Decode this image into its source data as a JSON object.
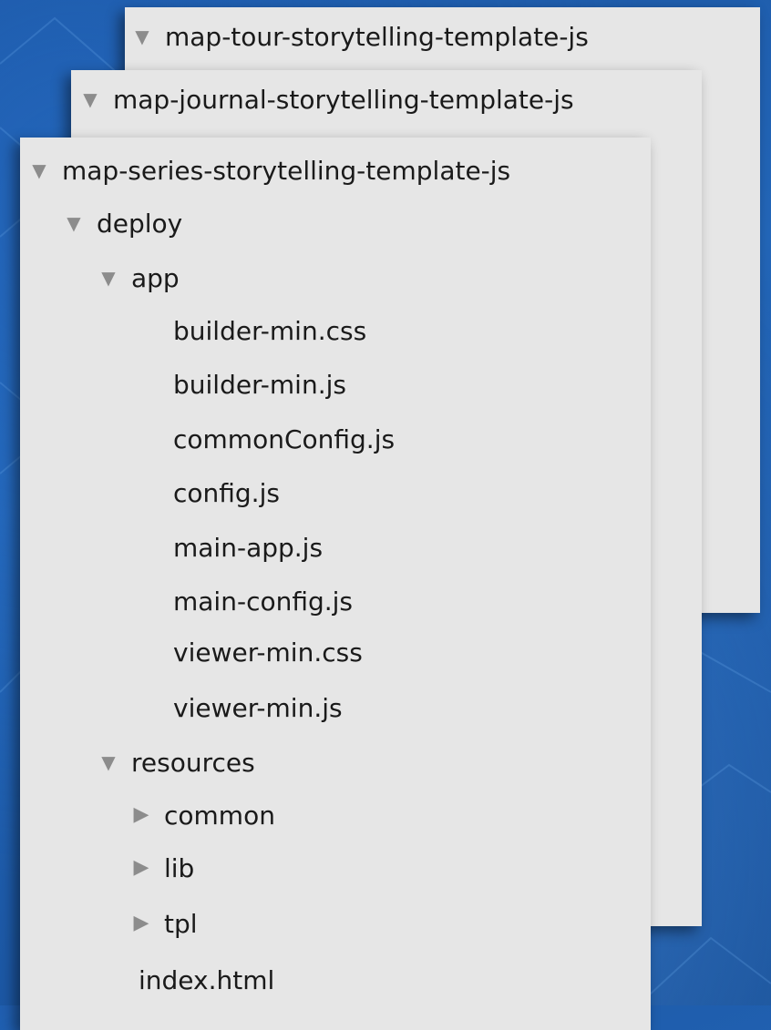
{
  "panels": {
    "tour": {
      "title": "map-tour-storytelling-template-js"
    },
    "journal": {
      "title": "map-journal-storytelling-template-js"
    },
    "series": {
      "title": "map-series-storytelling-template-js",
      "deploy": {
        "label": "deploy"
      },
      "app": {
        "label": "app",
        "files": [
          "builder-min.css",
          "builder-min.js",
          "commonConfig.js",
          "config.js",
          "main-app.js",
          "main-config.js",
          "viewer-min.css",
          "viewer-min.js"
        ]
      },
      "resources": {
        "label": "resources",
        "folders": [
          "common",
          "lib",
          "tpl"
        ]
      },
      "index_file": "index.html"
    }
  },
  "icons": {
    "expanded": "triangle-down-icon",
    "collapsed": "triangle-right-icon",
    "expanded_glyph": "▼",
    "collapsed_glyph": "▶"
  },
  "colors": {
    "panel_bg": "#e6e6e6",
    "triangle": "#8c8c8c",
    "desktop_blue": "#1f5fae"
  }
}
